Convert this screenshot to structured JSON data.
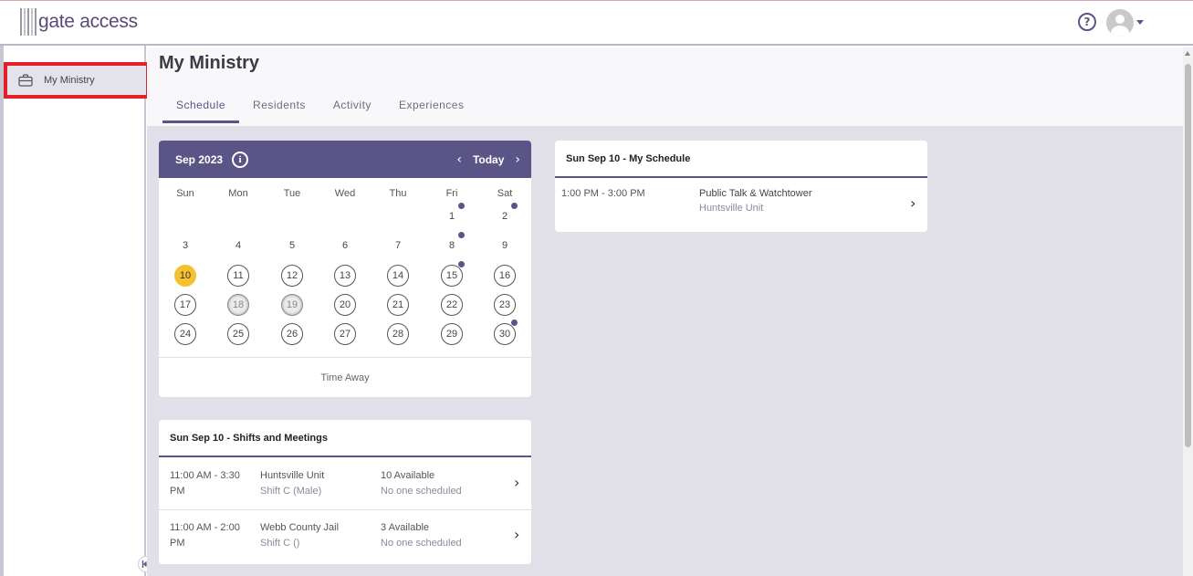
{
  "app": {
    "logo_text": "gate access"
  },
  "sidebar": {
    "items": [
      {
        "label": "My Ministry",
        "icon": "briefcase-icon"
      }
    ]
  },
  "page": {
    "title": "My Ministry",
    "tabs": [
      {
        "label": "Schedule",
        "active": true
      },
      {
        "label": "Residents",
        "active": false
      },
      {
        "label": "Activity",
        "active": false
      },
      {
        "label": "Experiences",
        "active": false
      }
    ]
  },
  "calendar": {
    "month_label": "Sep 2023",
    "today_label": "Today",
    "weekdays": [
      "Sun",
      "Mon",
      "Tue",
      "Wed",
      "Thu",
      "Fri",
      "Sat"
    ],
    "weeks": [
      [
        null,
        null,
        null,
        null,
        null,
        {
          "d": "1",
          "dot": true,
          "style": "plain"
        },
        {
          "d": "2",
          "dot": true,
          "style": "plain"
        }
      ],
      [
        {
          "d": "3",
          "style": "plain"
        },
        {
          "d": "4",
          "style": "plain"
        },
        {
          "d": "5",
          "style": "plain"
        },
        {
          "d": "6",
          "style": "plain"
        },
        {
          "d": "7",
          "style": "plain"
        },
        {
          "d": "8",
          "dot": true,
          "style": "plain"
        },
        {
          "d": "9",
          "style": "plain"
        }
      ],
      [
        {
          "d": "10",
          "style": "today"
        },
        {
          "d": "11",
          "style": "circle"
        },
        {
          "d": "12",
          "style": "circle"
        },
        {
          "d": "13",
          "style": "circle"
        },
        {
          "d": "14",
          "style": "circle"
        },
        {
          "d": "15",
          "dot": true,
          "style": "circle"
        },
        {
          "d": "16",
          "style": "circle"
        }
      ],
      [
        {
          "d": "17",
          "style": "circle"
        },
        {
          "d": "18",
          "style": "past"
        },
        {
          "d": "19",
          "style": "past"
        },
        {
          "d": "20",
          "style": "circle"
        },
        {
          "d": "21",
          "style": "circle"
        },
        {
          "d": "22",
          "style": "circle"
        },
        {
          "d": "23",
          "style": "circle"
        }
      ],
      [
        {
          "d": "24",
          "style": "circle"
        },
        {
          "d": "25",
          "style": "circle"
        },
        {
          "d": "26",
          "style": "circle"
        },
        {
          "d": "27",
          "style": "circle"
        },
        {
          "d": "28",
          "style": "circle"
        },
        {
          "d": "29",
          "style": "circle"
        },
        {
          "d": "30",
          "dot": true,
          "style": "circle"
        }
      ]
    ],
    "footer_label": "Time Away"
  },
  "my_schedule": {
    "title": "Sun Sep 10 - My Schedule",
    "items": [
      {
        "time": "1:00 PM - 3:00 PM",
        "title": "Public Talk & Watchtower",
        "location": "Huntsville Unit"
      }
    ]
  },
  "shifts": {
    "title": "Sun Sep 10 - Shifts and Meetings",
    "items": [
      {
        "time_line1": "11:00 AM - 3:30",
        "time_line2": "PM",
        "location": "Huntsville Unit",
        "shift": "Shift C (Male)",
        "available": "10 Available",
        "scheduled": "No one scheduled"
      },
      {
        "time_line1": "11:00 AM - 2:00",
        "time_line2": "PM",
        "location": "Webb County Jail",
        "shift": "Shift C ()",
        "available": "3 Available",
        "scheduled": "No one scheduled"
      }
    ]
  },
  "colors": {
    "brand": "#5b5486",
    "today": "#f5c12e",
    "highlight_border": "#e3212b"
  }
}
